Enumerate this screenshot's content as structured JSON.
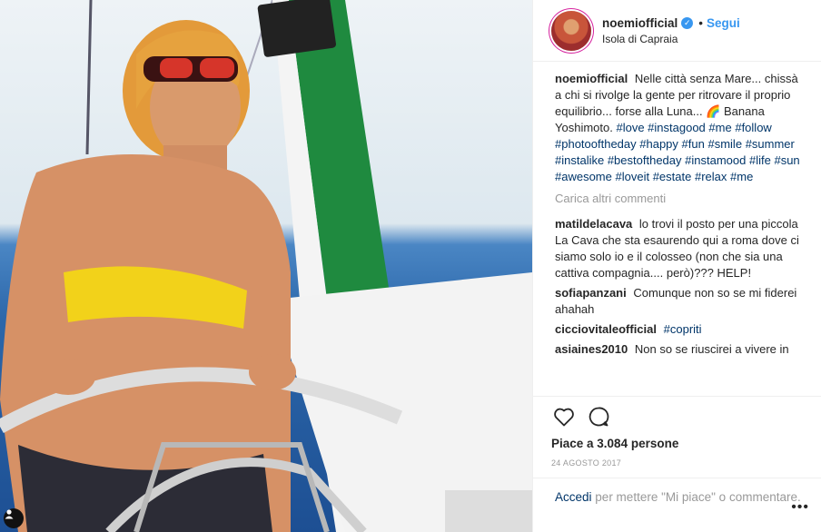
{
  "header": {
    "username": "noemiofficial",
    "dot": "•",
    "follow_label": "Segui",
    "location": "Isola di Capraia"
  },
  "caption": {
    "username": "noemiofficial",
    "text": "Nelle città senza Mare... chissà a chi si rivolge la gente per ritrovare il proprio equilibrio... forse alla Luna... 🌈 Banana Yoshimoto.",
    "hashtags": [
      "#love",
      "#instagood",
      "#me",
      "#follow",
      "#photooftheday",
      "#happy",
      "#fun",
      "#smile",
      "#summer",
      "#instalike",
      "#bestoftheday",
      "#instamood",
      "#life",
      "#sun",
      "#awesome",
      "#loveit",
      "#estate",
      "#relax",
      "#me"
    ]
  },
  "load_more_label": "Carica altri commenti",
  "comments": [
    {
      "username": "matildelacava",
      "text": "lo trovi il posto per una piccola La Cava che sta esaurendo qui a roma dove ci siamo solo io e il colosseo (non che sia una cattiva compagnia.... però)??? HELP!"
    },
    {
      "username": "sofiapanzani",
      "text": "Comunque non so se mi fiderei ahahah"
    },
    {
      "username": "cicciovitaleofficial",
      "text": "",
      "tag": "#copriti"
    },
    {
      "username": "asiaines2010",
      "text": "Non so se riuscirei a vivere in"
    }
  ],
  "likes_label": "Piace a 3.084 persone",
  "date": "24 AGOSTO 2017",
  "login": {
    "link_label": "Accedi",
    "text": "per mettere \"Mi piace\" o commentare."
  },
  "more_label": "•••",
  "icons": {
    "like": "heart-icon",
    "comment": "comment-bubble-icon",
    "verified": "verified-badge-icon",
    "user_tag": "user-tag-icon"
  },
  "colors": {
    "link_blue": "#3897f0",
    "hashtag_blue": "#003569",
    "muted": "#999999",
    "bikini_yellow": "#f2d21a"
  }
}
